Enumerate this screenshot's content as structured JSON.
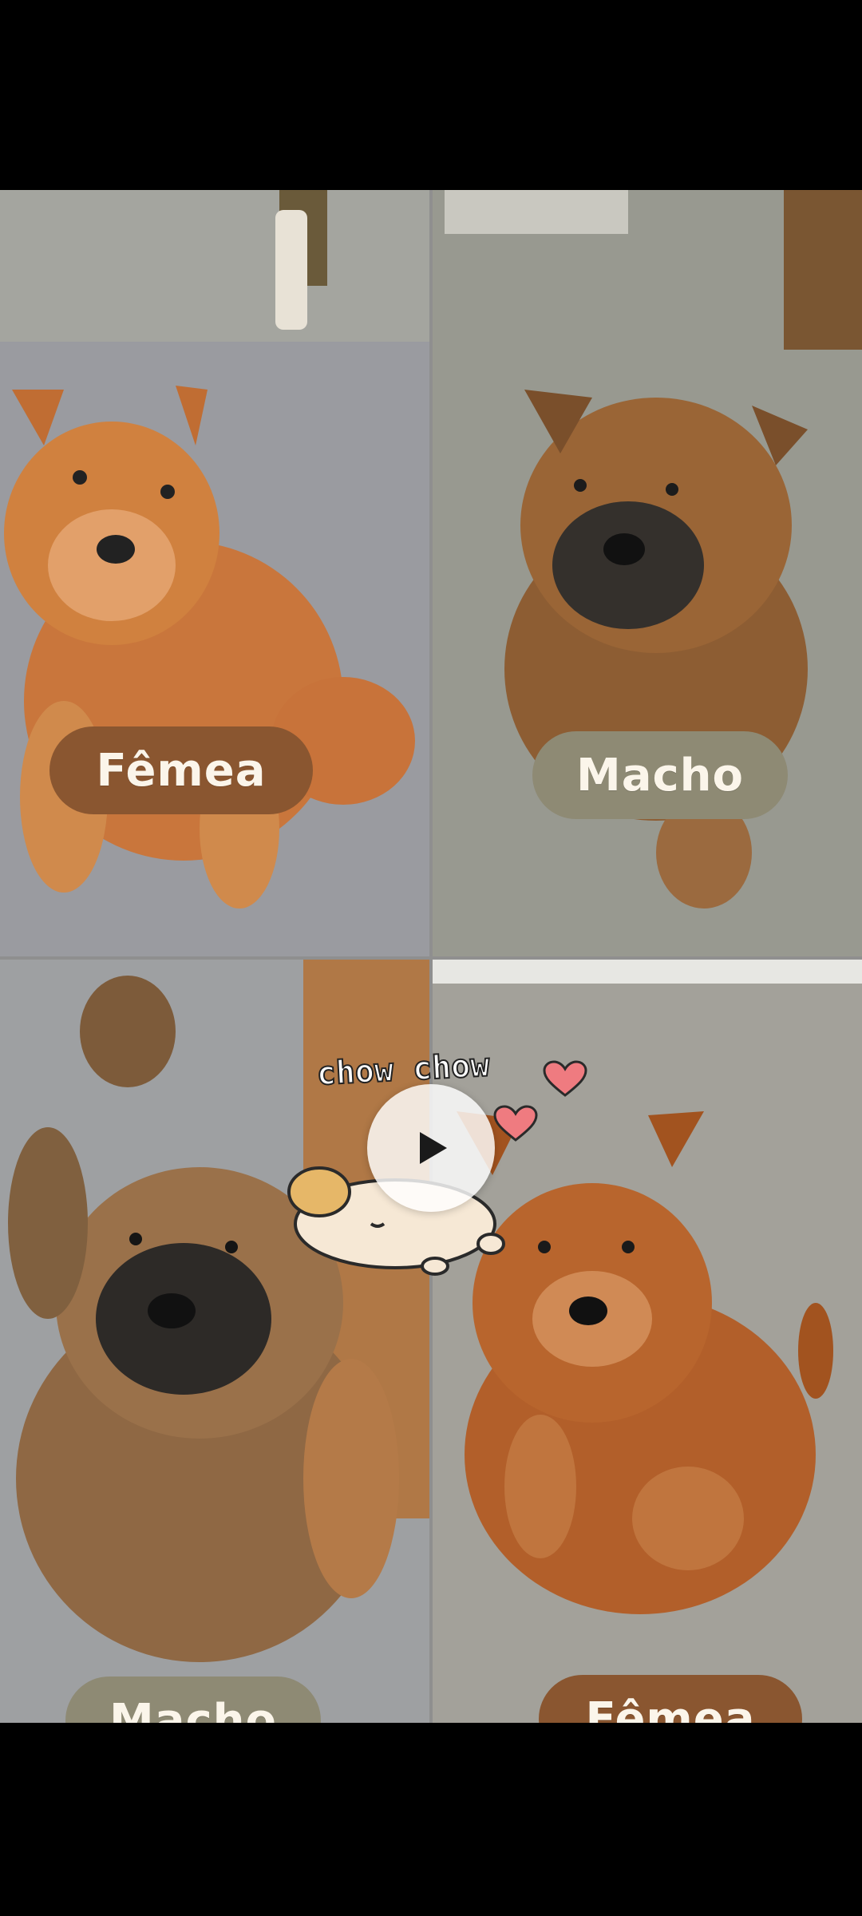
{
  "video": {
    "sticker_text": "chow chow",
    "play_icon": "play-icon",
    "labels": {
      "top_left": "Fêmea",
      "top_right": "Macho",
      "bottom_left": "Macho",
      "bottom_right": "Fêmea"
    },
    "colors": {
      "female_pill": "#8a5630",
      "male_pill": "#8e8a74",
      "background": "#000000"
    }
  }
}
